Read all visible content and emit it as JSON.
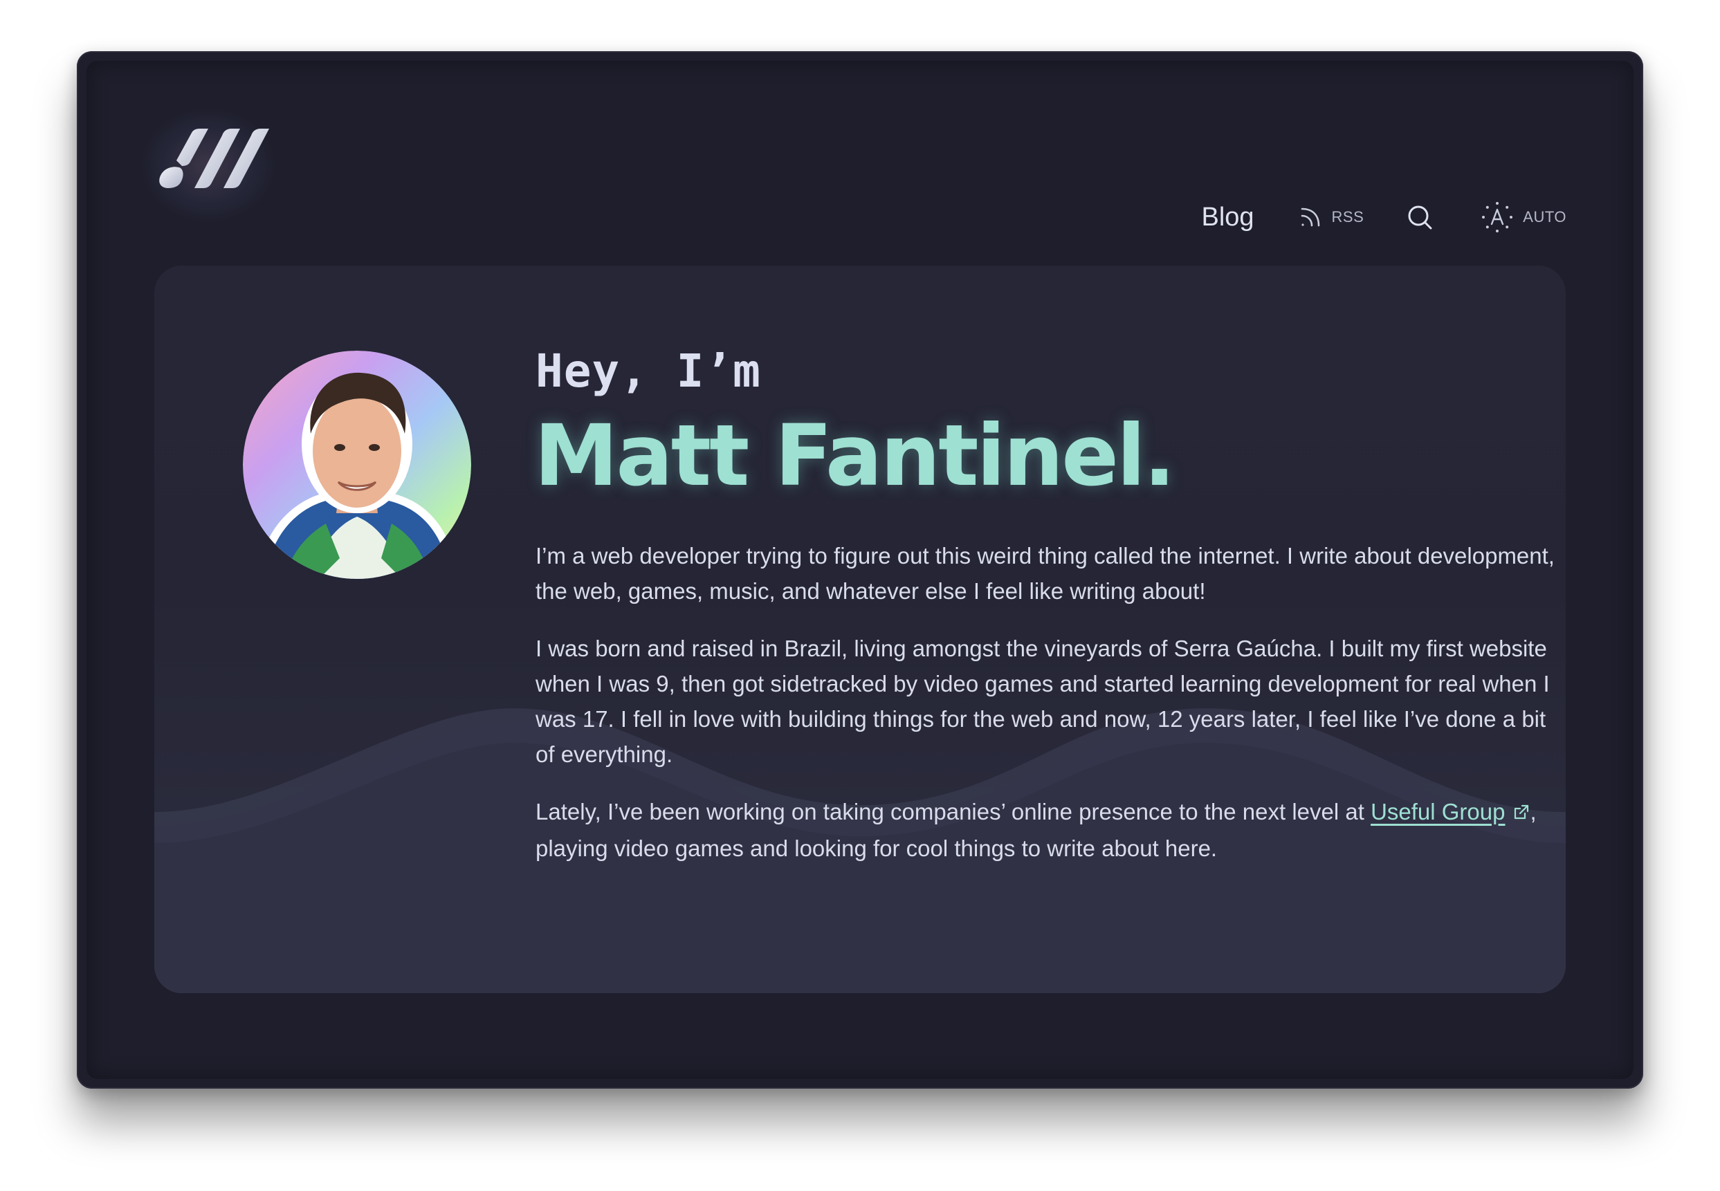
{
  "header": {
    "logo_icon": "slanted-bars-logo",
    "nav": {
      "blog_label": "Blog",
      "rss_label": "RSS",
      "rss_icon": "rss-icon",
      "search_icon": "search-icon",
      "theme_icon": "auto-theme-icon",
      "theme_label": "AUTO"
    }
  },
  "hero": {
    "greeting": "Hey, I’m",
    "name": "Matt Fantinel.",
    "paragraphs": {
      "p1": "I’m a web developer trying to figure out this weird thing called the internet. I write about development, the web, games, music, and whatever else I feel like writing about!",
      "p2": "I was born and raised in Brazil, living amongst the vineyards of Serra Gaúcha. I built my first website when I was 9, then got sidetracked by video games and started learning development for real when I was 17. I fell in love with building things for the web and now, 12 years later, I feel like I’ve done a bit of everything.",
      "p3_before": "Lately, I’ve been working on taking companies’ online presence to the next level at ",
      "p3_link": "Useful Group",
      "p3_after": ", playing video games and looking for cool things to write about here."
    },
    "avatar_icon": "profile-photo"
  },
  "colors": {
    "background": "#1e1e2c",
    "card": "#262636",
    "accent": "#9ee0d2",
    "text": "#d9dcea"
  }
}
